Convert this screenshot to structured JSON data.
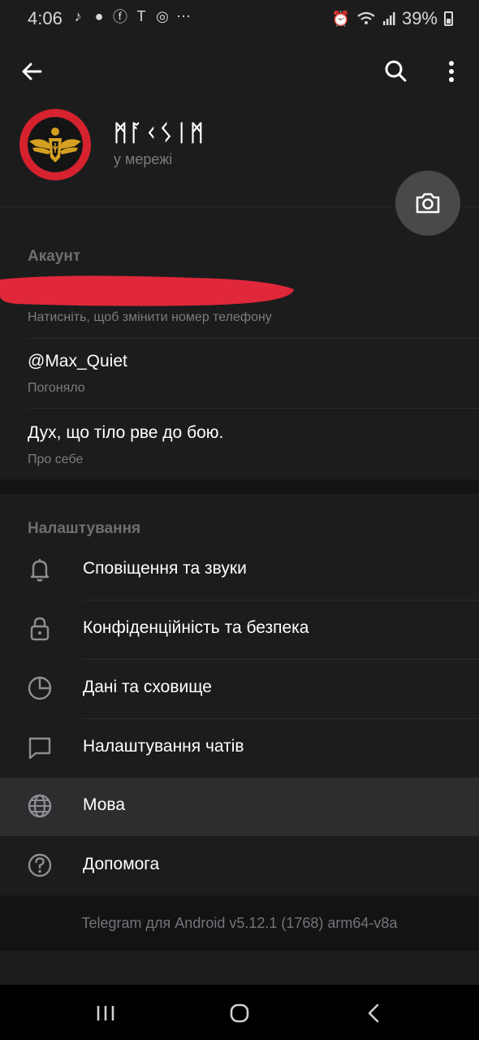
{
  "status_bar": {
    "time": "4:06",
    "battery": "39%"
  },
  "profile": {
    "name": "ᛗᚪᚲᛊᛁᛗ",
    "status": "у мережі"
  },
  "account": {
    "section_title": "Акаунт",
    "phone_hint": "Натисніть, щоб змінити номер телефону",
    "username": "@Max_Quiet",
    "username_label": "Погоняло",
    "bio": "Дух, що тіло рве до бою.",
    "bio_label": "Про себе"
  },
  "settings": {
    "section_title": "Налаштування",
    "items": [
      {
        "label": "Сповіщення та звуки",
        "icon": "bell-icon"
      },
      {
        "label": "Конфіденційність та безпека",
        "icon": "lock-icon"
      },
      {
        "label": "Дані та сховище",
        "icon": "pie-chart-icon"
      },
      {
        "label": "Налаштування чатів",
        "icon": "chat-bubble-icon"
      },
      {
        "label": "Мова",
        "icon": "globe-icon"
      },
      {
        "label": "Допомога",
        "icon": "help-icon"
      }
    ]
  },
  "footer": {
    "version": "Telegram для Android v5.12.1 (1768) arm64-v8a"
  },
  "colors": {
    "background": "#1c1c1d",
    "avatar_ring": "#d6222e",
    "redaction": "#e0283a",
    "highlight_row": "#2d2d2f"
  }
}
